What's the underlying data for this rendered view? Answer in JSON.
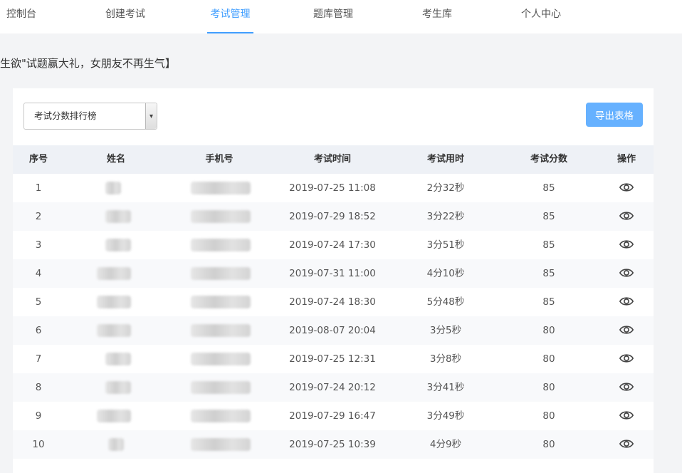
{
  "nav": {
    "items": [
      {
        "label": "控制台",
        "active": false
      },
      {
        "label": "创建考试",
        "active": false
      },
      {
        "label": "考试管理",
        "active": true
      },
      {
        "label": "题库管理",
        "active": false
      },
      {
        "label": "考生库",
        "active": false
      },
      {
        "label": "个人中心",
        "active": false
      }
    ],
    "accent_color": "#409eff"
  },
  "banner": {
    "text": "生欲\"试题赢大礼，女朋友不再生气】"
  },
  "toolbar": {
    "select_value": "考试分数排行榜",
    "export_label": "导出表格"
  },
  "table": {
    "headers": {
      "index": "序号",
      "name": "姓名",
      "phone": "手机号",
      "time": "考试时间",
      "duration": "考试用时",
      "score": "考试分数",
      "action": "操作"
    },
    "rows": [
      {
        "index": "1",
        "time": "2019-07-25 11:08",
        "duration": "2分32秒",
        "score": "85"
      },
      {
        "index": "2",
        "time": "2019-07-29 18:52",
        "duration": "3分22秒",
        "score": "85"
      },
      {
        "index": "3",
        "time": "2019-07-24 17:30",
        "duration": "3分51秒",
        "score": "85"
      },
      {
        "index": "4",
        "time": "2019-07-31 11:00",
        "duration": "4分10秒",
        "score": "85"
      },
      {
        "index": "5",
        "time": "2019-07-24 18:30",
        "duration": "5分48秒",
        "score": "85"
      },
      {
        "index": "6",
        "time": "2019-08-07 20:04",
        "duration": "3分5秒",
        "score": "80"
      },
      {
        "index": "7",
        "time": "2019-07-25 12:31",
        "duration": "3分8秒",
        "score": "80"
      },
      {
        "index": "8",
        "time": "2019-07-24 20:12",
        "duration": "3分41秒",
        "score": "80"
      },
      {
        "index": "9",
        "time": "2019-07-29 16:47",
        "duration": "3分49秒",
        "score": "80"
      },
      {
        "index": "10",
        "time": "2019-07-25 10:39",
        "duration": "4分9秒",
        "score": "80"
      }
    ],
    "action_icon": "eye-icon"
  }
}
